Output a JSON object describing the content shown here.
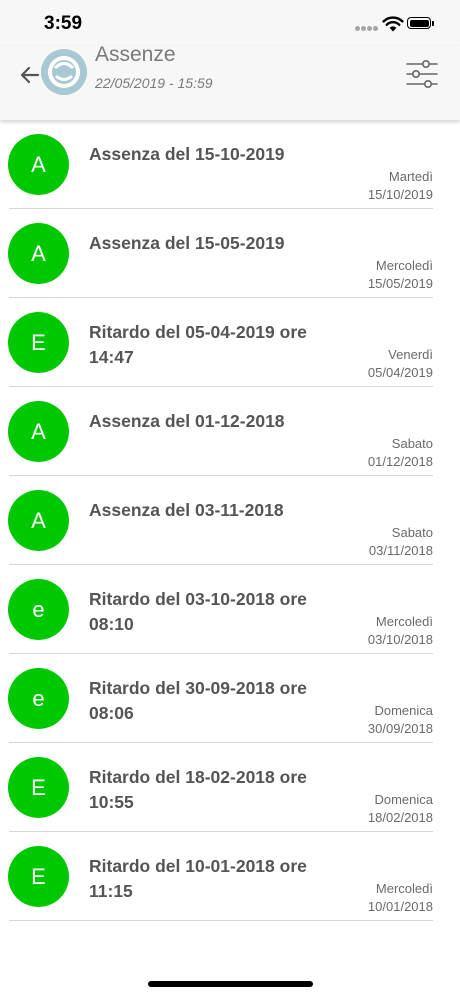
{
  "status_bar": {
    "time": "3:59"
  },
  "header": {
    "title": "Assenze",
    "subtitle": "22/05/2019 - 15:59",
    "back_icon": "arrow-left-icon",
    "filter_icon": "sliders-icon"
  },
  "colors": {
    "badge": "#00c800",
    "header_bg": "#f7f7f7"
  },
  "items": [
    {
      "badge": "A",
      "title": "Assenza del 15-10-2019",
      "day": "Martedì",
      "date": "15/10/2019"
    },
    {
      "badge": "A",
      "title": "Assenza del 15-05-2019",
      "day": "Mercoledì",
      "date": "15/05/2019"
    },
    {
      "badge": "E",
      "title": "Ritardo del 05-04-2019 ore 14:47",
      "day": "Venerdì",
      "date": "05/04/2019"
    },
    {
      "badge": "A",
      "title": "Assenza del 01-12-2018",
      "day": "Sabato",
      "date": "01/12/2018"
    },
    {
      "badge": "A",
      "title": "Assenza del 03-11-2018",
      "day": "Sabato",
      "date": "03/11/2018"
    },
    {
      "badge": "e",
      "title": "Ritardo del 03-10-2018 ore 08:10",
      "day": "Mercoledì",
      "date": "03/10/2018"
    },
    {
      "badge": "e",
      "title": "Ritardo del 30-09-2018 ore 08:06",
      "day": "Domenica",
      "date": "30/09/2018"
    },
    {
      "badge": "E",
      "title": "Ritardo del 18-02-2018 ore 10:55",
      "day": "Domenica",
      "date": "18/02/2018"
    },
    {
      "badge": "E",
      "title": "Ritardo del 10-01-2018 ore 11:15",
      "day": "Mercoledì",
      "date": "10/01/2018"
    }
  ]
}
